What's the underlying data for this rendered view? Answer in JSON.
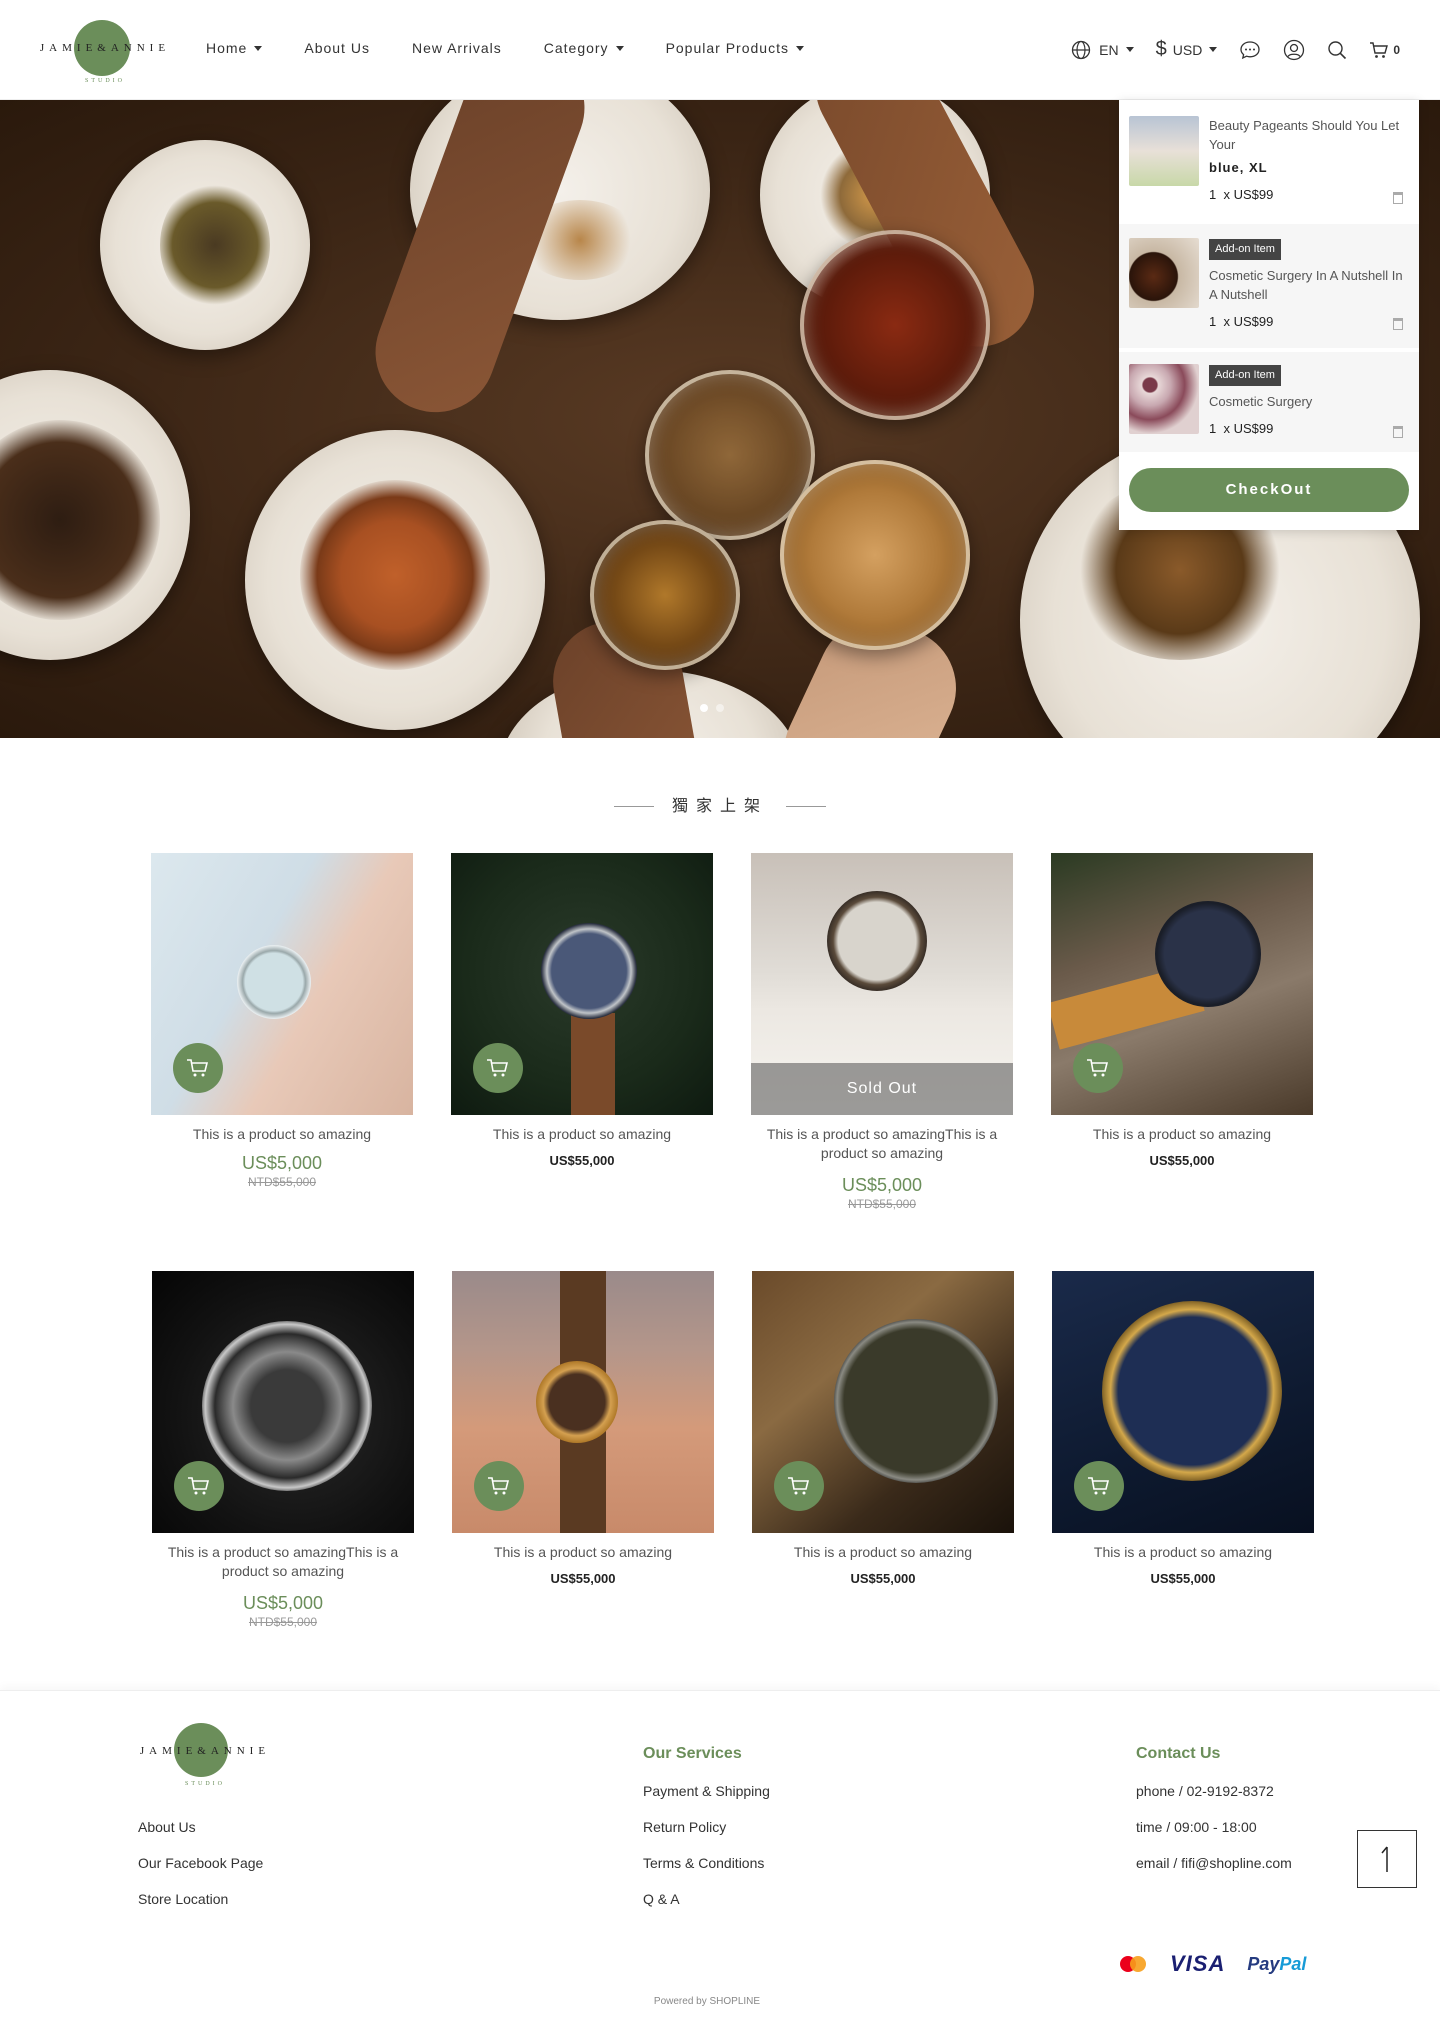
{
  "brand": {
    "name": "JAMIE&ANNIE",
    "sub": "STUDIO"
  },
  "nav": [
    {
      "label": "Home",
      "dropdown": true
    },
    {
      "label": "About Us",
      "dropdown": false
    },
    {
      "label": "New Arrivals",
      "dropdown": false
    },
    {
      "label": "Category",
      "dropdown": true
    },
    {
      "label": "Popular Products",
      "dropdown": true
    }
  ],
  "tools": {
    "language": "EN",
    "currency": "USD",
    "cart_count": "0"
  },
  "cart": {
    "items": [
      {
        "title": "Beauty Pageants Should You Let Your",
        "variant": "blue, XL",
        "qty": "1",
        "price": "x US$99",
        "addon": ""
      },
      {
        "title": "Cosmetic Surgery In A Nutshell In A Nutshell",
        "variant": "",
        "qty": "1",
        "price": "x US$99",
        "addon": "Add-on Item"
      },
      {
        "title": "Cosmetic Surgery",
        "variant": "",
        "qty": "1",
        "price": "x US$99",
        "addon": "Add-on Item"
      }
    ],
    "checkout_label": "CheckOut"
  },
  "section_title": "獨家上架",
  "products": [
    {
      "name": "This is a product so amazing",
      "price": "US$5,000",
      "old_price": "NTD$55,000",
      "sold_out": ""
    },
    {
      "name": "This is a product so amazing",
      "price": "US$55,000",
      "old_price": "",
      "sold_out": ""
    },
    {
      "name": "This is a product so amazingThis is a product so amazing",
      "price": "US$5,000",
      "old_price": "NTD$55,000",
      "sold_out": "Sold Out"
    },
    {
      "name": "This is a product so amazing",
      "price": "US$55,000",
      "old_price": "",
      "sold_out": ""
    },
    {
      "name": "This is a product so amazingThis is a product so amazing",
      "price": "US$5,000",
      "old_price": "NTD$55,000",
      "sold_out": ""
    },
    {
      "name": "This is a product so amazing",
      "price": "US$55,000",
      "old_price": "",
      "sold_out": ""
    },
    {
      "name": "This is a product so amazing",
      "price": "US$55,000",
      "old_price": "",
      "sold_out": ""
    },
    {
      "name": "This is a product so amazing",
      "price": "US$55,000",
      "old_price": "",
      "sold_out": ""
    }
  ],
  "footer": {
    "col1": [
      "About Us",
      "Our Facebook Page",
      "Store Location"
    ],
    "services_title": "Our Services",
    "services": [
      "Payment & Shipping",
      "Return Policy",
      "Terms & Conditions",
      "Q & A"
    ],
    "contact_title": "Contact Us",
    "contact": [
      "phone / 02-9192-8372",
      "time / 09:00 - 18:00",
      "email / fifi@shopline.com"
    ],
    "payments": {
      "visa": "VISA",
      "paypal_a": "Pay",
      "paypal_b": "Pal"
    },
    "powered": "Powered by SHOPLINE"
  },
  "colors": {
    "accent": "#6b8e5a"
  }
}
